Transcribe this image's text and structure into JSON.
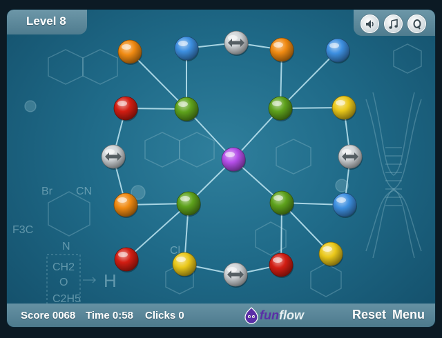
{
  "hud": {
    "level": "Level 8",
    "score": "Score 0068",
    "time": "Time 0:58",
    "clicks": "Clicks 0",
    "reset": "Reset",
    "menu": "Menu"
  },
  "logo": {
    "fun": "fun",
    "flow": "flow"
  },
  "buttons": [
    {
      "name": "sound-toggle-button",
      "icon": "speaker-icon"
    },
    {
      "name": "music-toggle-button",
      "icon": "music-note-icon"
    },
    {
      "name": "quality-toggle-button",
      "icon": "quality-q-icon"
    }
  ],
  "background_labels": {
    "br": "Br",
    "cn": "CN",
    "f3c": "F3C",
    "n": "N",
    "ch2": "CH2",
    "o": "O",
    "c2h5": "C2H5",
    "h": "H",
    "cl": "Cl"
  },
  "colors": {
    "orange": "#f08a12",
    "blue": "#3d8fe0",
    "red": "#d21d12",
    "green": "#5ea21c",
    "yellow": "#eac81a",
    "purple": "#b44ee8",
    "silver": "#cfd3d6",
    "link": "#bfe6f2"
  },
  "nodes": [
    {
      "id": "n1",
      "color": "orange"
    },
    {
      "id": "n2",
      "color": "blue"
    },
    {
      "id": "n3",
      "color": "silver"
    },
    {
      "id": "n4",
      "color": "orange"
    },
    {
      "id": "n5",
      "color": "blue"
    },
    {
      "id": "n6",
      "color": "red"
    },
    {
      "id": "n7",
      "color": "green"
    },
    {
      "id": "n8",
      "color": "green"
    },
    {
      "id": "n9",
      "color": "yellow"
    },
    {
      "id": "n10",
      "color": "silver"
    },
    {
      "id": "n11",
      "color": "purple"
    },
    {
      "id": "n12",
      "color": "silver"
    },
    {
      "id": "n13",
      "color": "orange"
    },
    {
      "id": "n14",
      "color": "green"
    },
    {
      "id": "n15",
      "color": "green"
    },
    {
      "id": "n16",
      "color": "blue"
    },
    {
      "id": "n17",
      "color": "red"
    },
    {
      "id": "n18",
      "color": "yellow"
    },
    {
      "id": "n19",
      "color": "silver"
    },
    {
      "id": "n20",
      "color": "red"
    },
    {
      "id": "n21",
      "color": "yellow"
    }
  ],
  "links": [
    [
      "n1",
      "n7"
    ],
    [
      "n2",
      "n7"
    ],
    [
      "n2",
      "n3"
    ],
    [
      "n3",
      "n4"
    ],
    [
      "n4",
      "n8"
    ],
    [
      "n5",
      "n8"
    ],
    [
      "n6",
      "n7"
    ],
    [
      "n7",
      "n11"
    ],
    [
      "n8",
      "n11"
    ],
    [
      "n8",
      "n9"
    ],
    [
      "n6",
      "n10"
    ],
    [
      "n10",
      "n13"
    ],
    [
      "n9",
      "n12"
    ],
    [
      "n12",
      "n16"
    ],
    [
      "n11",
      "n14"
    ],
    [
      "n11",
      "n15"
    ],
    [
      "n13",
      "n14"
    ],
    [
      "n15",
      "n16"
    ],
    [
      "n14",
      "n17"
    ],
    [
      "n14",
      "n18"
    ],
    [
      "n15",
      "n21"
    ],
    [
      "n15",
      "n20"
    ],
    [
      "n18",
      "n19"
    ],
    [
      "n19",
      "n20"
    ]
  ]
}
